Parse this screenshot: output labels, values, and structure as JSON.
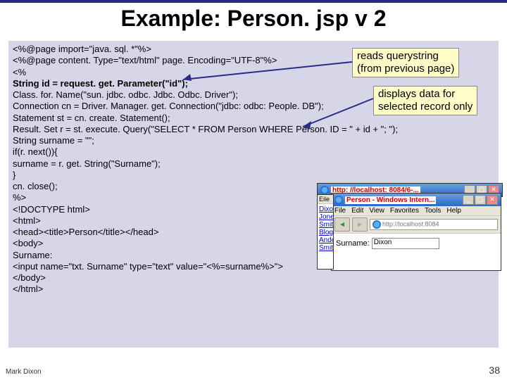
{
  "title": "Example: Person. jsp v 2",
  "code": {
    "l1": "<%@page import=\"java. sql. *\"%>",
    "l2": "<%@page content. Type=\"text/html\" page. Encoding=\"UTF-8\"%>",
    "l3": "<%",
    "l4": "String id = request. get. Parameter(\"id\");",
    "l5": "Class. for. Name(\"sun. jdbc. odbc. Jdbc. Odbc. Driver\");",
    "l6": "Connection cn = Driver. Manager. get. Connection(\"jdbc: odbc: People. DB\");",
    "l7": "Statement st  = cn. create. Statement();",
    "l8": "Result. Set r   = st. execute. Query(\"SELECT * FROM Person WHERE Person. ID = \" + id + \"; \");",
    "l9": "String surname = \"\";",
    "l10": "  if(r. next()){",
    "l11": "  surname = r. get. String(\"Surname\");",
    "l12": "  }",
    "l13": "  cn. close();",
    "l14": "%>",
    "l15": "<!DOCTYPE html>",
    "l16": "<html>",
    "l17": "  <head><title>Person</title></head>",
    "l18": "  <body>",
    "l19": "  Surname:",
    "l20": "  <input name=\"txt. Surname\" type=\"text\" value=\"<%=surname%>\">",
    "l21": "  </body>",
    "l22": "</html>"
  },
  "annotations": {
    "a1_line1": "reads querystring",
    "a1_line2": "(from previous page)",
    "a2_line1": "displays data for",
    "a2_line2": "selected record only"
  },
  "browser1": {
    "title_url": "http: //localhost: 8084/6-...",
    "menu": {
      "file": "Eile",
      "edit": "E"
    },
    "list": [
      "Dixon",
      "Jones",
      "Smith",
      "Bloggs",
      "Anderso",
      "Smith"
    ]
  },
  "browser2": {
    "title": "Person - Windows Intern...",
    "menu": {
      "file": "File",
      "edit": "Edit",
      "view": "View",
      "favorites": "Favorites",
      "tools": "Tools",
      "help": "Help"
    },
    "addr": "http://localhost:8084",
    "label": "Surname:",
    "value": "Dixon"
  },
  "footer": {
    "author": "Mark Dixon",
    "page": "38"
  }
}
